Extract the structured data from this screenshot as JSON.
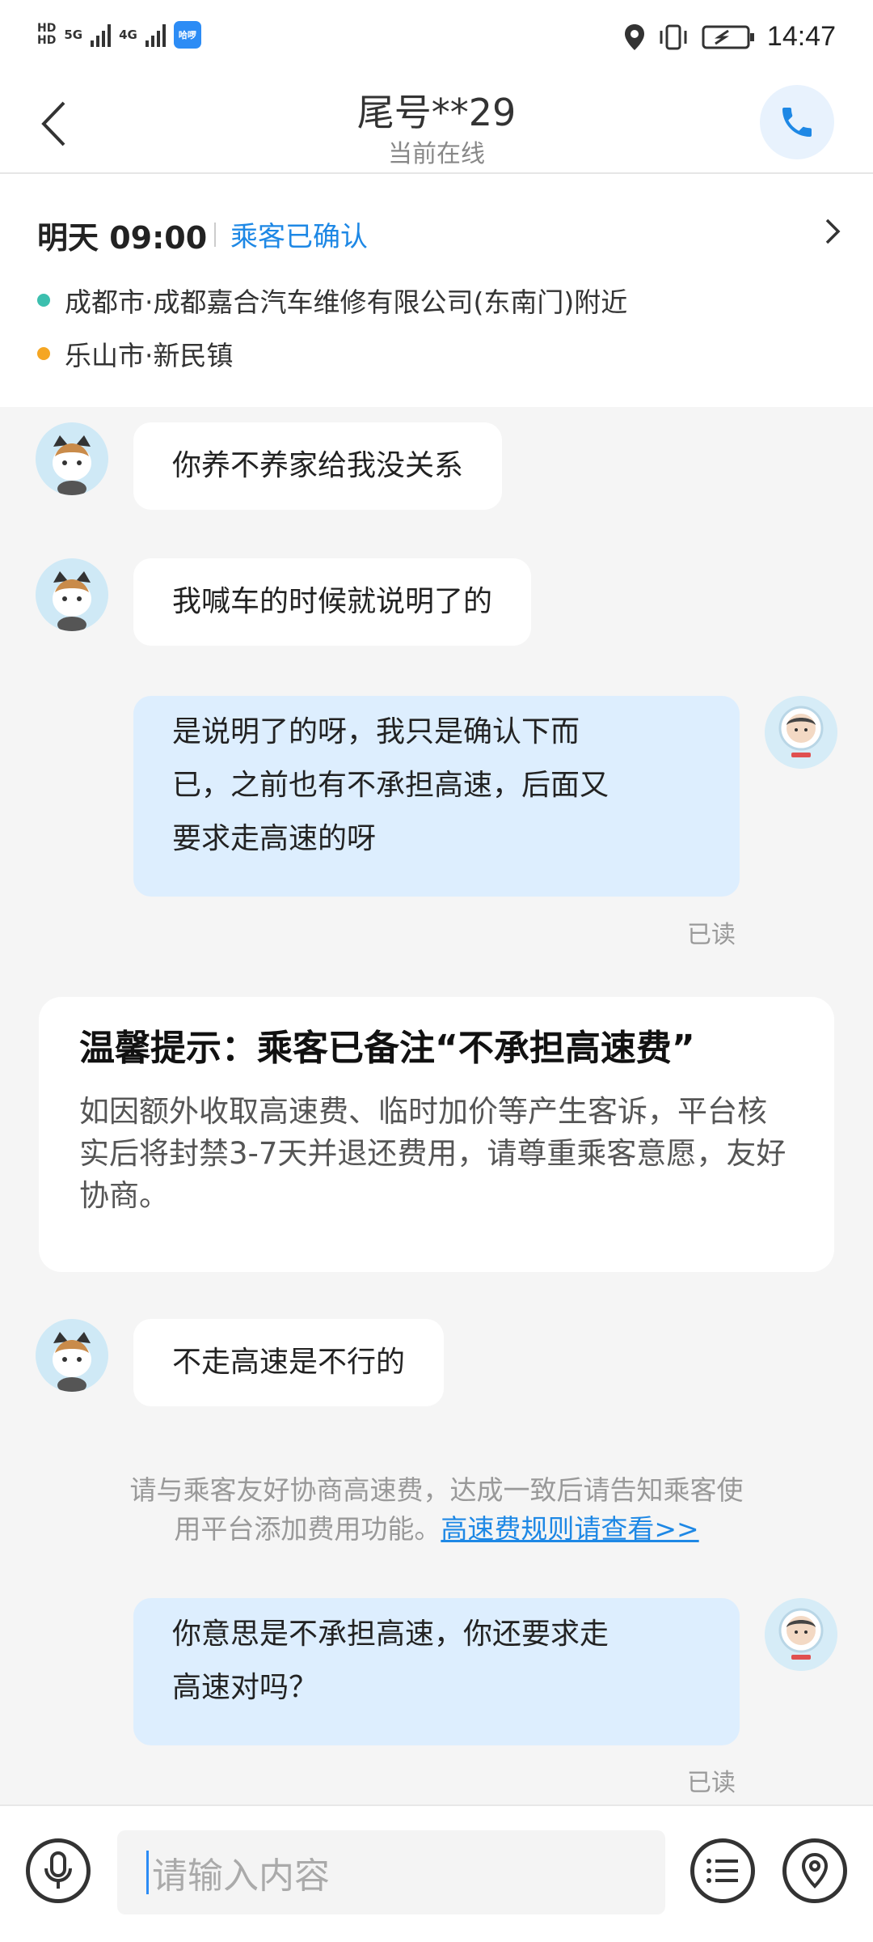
{
  "status_bar": {
    "hd": "HD",
    "network": "5G",
    "network2": "4G",
    "app_badge": "哈啰",
    "time": "14:47"
  },
  "header": {
    "title": "尾号**29",
    "subtitle": "当前在线",
    "icons": {
      "back": "chevron-left-icon",
      "call": "phone-icon"
    }
  },
  "order": {
    "time": "明天 09:00",
    "status": "乘客已确认",
    "start": {
      "text": "成都市·成都嘉合汽车维修有限公司(东南门)附近",
      "color": "#3cbfae"
    },
    "end": {
      "text": "乐山市·新民镇",
      "color": "#f5a623"
    }
  },
  "messages": {
    "m1": "你养不养家给我没关系",
    "m2": "我喊车的时候就说明了的",
    "m3_l1": "是说明了的呀，我只是确认下而",
    "m3_l2": "已，之前也有不承担高速，后面又",
    "m3_l3": "要求走高速的呀",
    "read1": "已读",
    "m4": "不走高速是不行的",
    "m5_l1": "你意思是不承担高速，你还要求走",
    "m5_l2": "高速对吗？",
    "read2": "已读"
  },
  "tip": {
    "title": "温馨提示：乘客已备注“不承担高速费”",
    "body": "如因额外收取高速费、临时加价等产生客诉，平台核实后将封禁3-7天并退还费用，请尊重乘客意愿，友好协商。"
  },
  "system_note": {
    "line1": "请与乘客友好协商高速费，达成一致后请告知乘客使",
    "line2": "用平台添加费用功能。",
    "link": "高速费规则请查看>>"
  },
  "input": {
    "placeholder": "请输入内容",
    "icons": {
      "voice": "microphone-icon",
      "menu": "list-menu-icon",
      "location": "location-pin-icon"
    }
  },
  "colors": {
    "accent": "#1e88e5",
    "bubble_out": "#ddeefe",
    "background": "#f5f5f5"
  }
}
